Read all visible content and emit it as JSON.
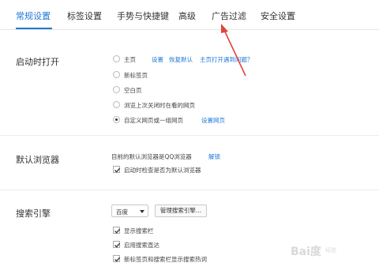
{
  "tabs": [
    {
      "label": "常规设置"
    },
    {
      "label": "标签设置"
    },
    {
      "label": "手势与快捷键"
    },
    {
      "label": "高级"
    },
    {
      "label": "广告过滤"
    },
    {
      "label": "安全设置"
    }
  ],
  "startup": {
    "title": "启动时打开",
    "options": [
      {
        "label": "主页",
        "checked": false
      },
      {
        "label": "新标签页",
        "checked": false
      },
      {
        "label": "空白页",
        "checked": false
      },
      {
        "label": "浏览上次关闭时在看的网页",
        "checked": false
      },
      {
        "label": "自定义网页或一组网页",
        "checked": true
      }
    ],
    "homepage_links": {
      "settings": "设置",
      "restore_default": "恢复默认",
      "problem": "主页打开遇到问题？"
    },
    "set_pages_link": "设置网页"
  },
  "default_browser": {
    "title": "默认浏览器",
    "status_text": "目前的默认浏览器是QQ浏览器",
    "unlock_link": "解锁",
    "check_label": "启动时检查是否为默认浏览器",
    "check_checked": true
  },
  "search": {
    "title": "搜索引擎",
    "engine_value": "百度",
    "manage_button": "管理搜索引擎...",
    "checks": [
      {
        "label": "显示搜索栏",
        "checked": true
      },
      {
        "label": "启用搜索直达",
        "checked": true
      },
      {
        "label": "新标签页和搜索栏显示搜索热词",
        "checked": true
      }
    ]
  },
  "colors": {
    "accent": "#1e78d6",
    "arrow": "#e0453a"
  },
  "watermark": {
    "text": "Bai度",
    "sub": "经验"
  }
}
